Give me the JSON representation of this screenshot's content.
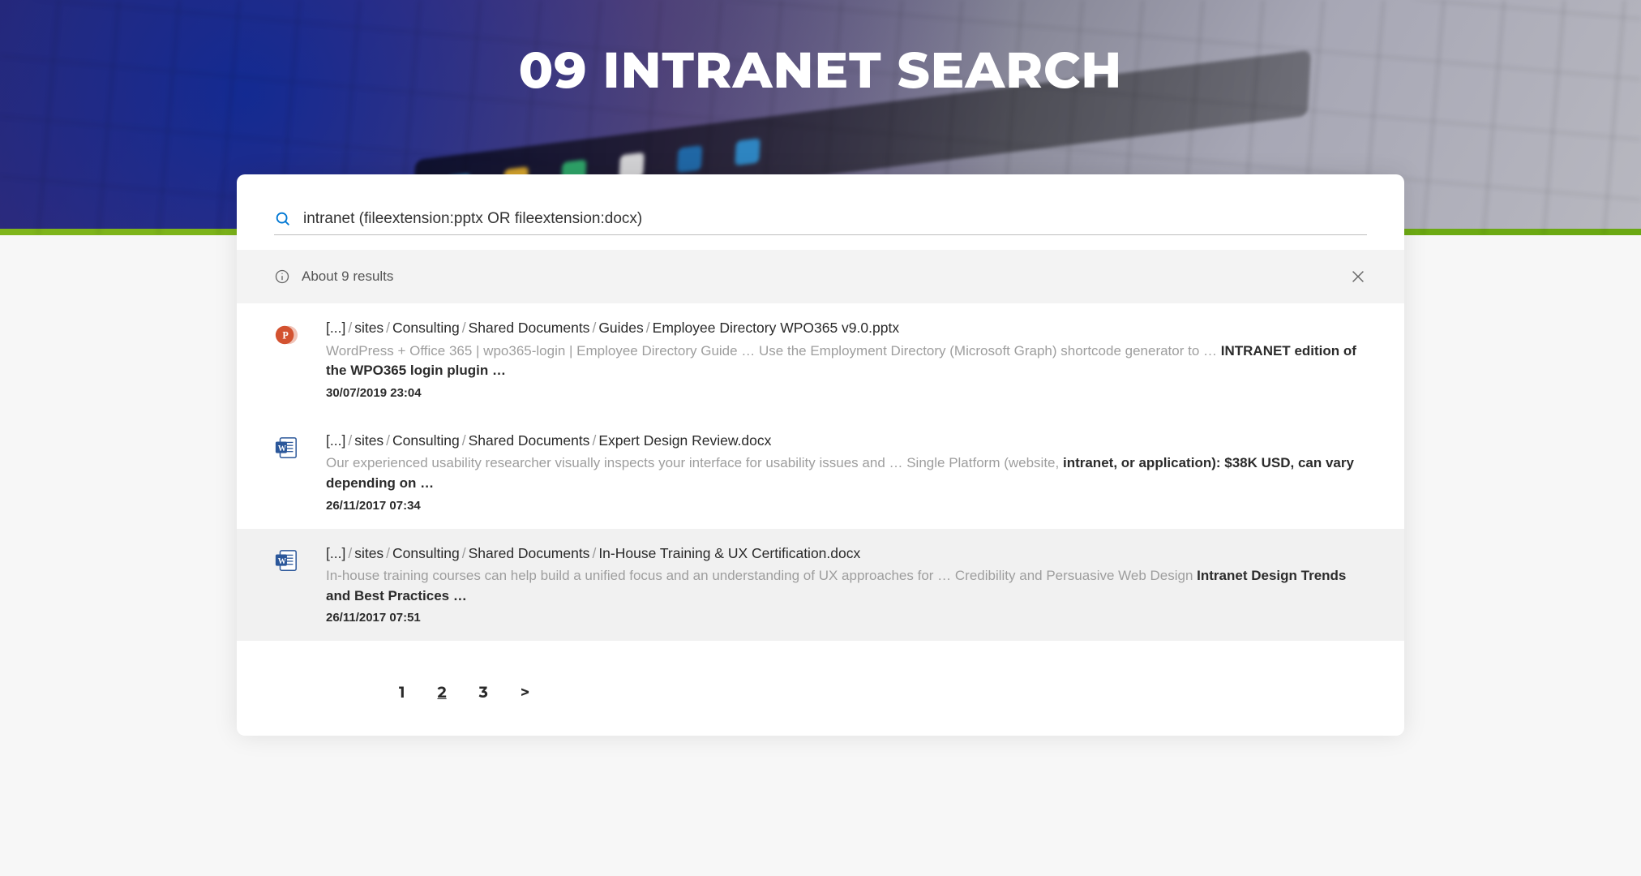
{
  "hero": {
    "title": "09 INTRANET SEARCH"
  },
  "search": {
    "query": "intranet (fileextension:pptx OR fileextension:docx)"
  },
  "summary": {
    "text": "About 9 results"
  },
  "results": [
    {
      "filetype": "pptx",
      "path": [
        "[...]",
        "sites",
        "Consulting",
        "Shared Documents",
        "Guides"
      ],
      "filename": "Employee Directory WPO365 v9.0.pptx",
      "snippet_pre": "WordPress + Office 365 | wpo365-login | Employee Directory Guide … Use the Employment Directory (Microsoft Graph) shortcode generator to … ",
      "snippet_bold1": "INTRANET",
      "snippet_mid": " ",
      "snippet_bold2": "edition of the WPO365 login plugin …",
      "timestamp": "30/07/2019 23:04",
      "highlight": false
    },
    {
      "filetype": "docx",
      "path": [
        "[...]",
        "sites",
        "Consulting",
        "Shared Documents"
      ],
      "filename": "Expert Design Review.docx",
      "snippet_pre": "Our experienced usability researcher visually inspects your interface for usability issues and … Single Platform (website, ",
      "snippet_bold1": "intranet",
      "snippet_mid": "",
      "snippet_bold2": ", or application): $38K USD, can vary depending on …",
      "timestamp": "26/11/2017 07:34",
      "highlight": false
    },
    {
      "filetype": "docx",
      "path": [
        "[...]",
        "sites",
        "Consulting",
        "Shared Documents"
      ],
      "filename": "In-House Training & UX Certification.docx",
      "snippet_pre": "In-house training courses can help build a unified focus and an understanding of UX approaches for … Credibility and Persuasive Web Design ",
      "snippet_bold1": "Intranet",
      "snippet_mid": " ",
      "snippet_bold2": "Design Trends and Best Practices …",
      "timestamp": "26/11/2017 07:51",
      "highlight": true
    }
  ],
  "pagination": {
    "pages": [
      "1",
      "2",
      "3"
    ],
    "current": "2",
    "next_label": ">"
  },
  "colors": {
    "ppt": "#d35230",
    "word": "#2b579a"
  }
}
